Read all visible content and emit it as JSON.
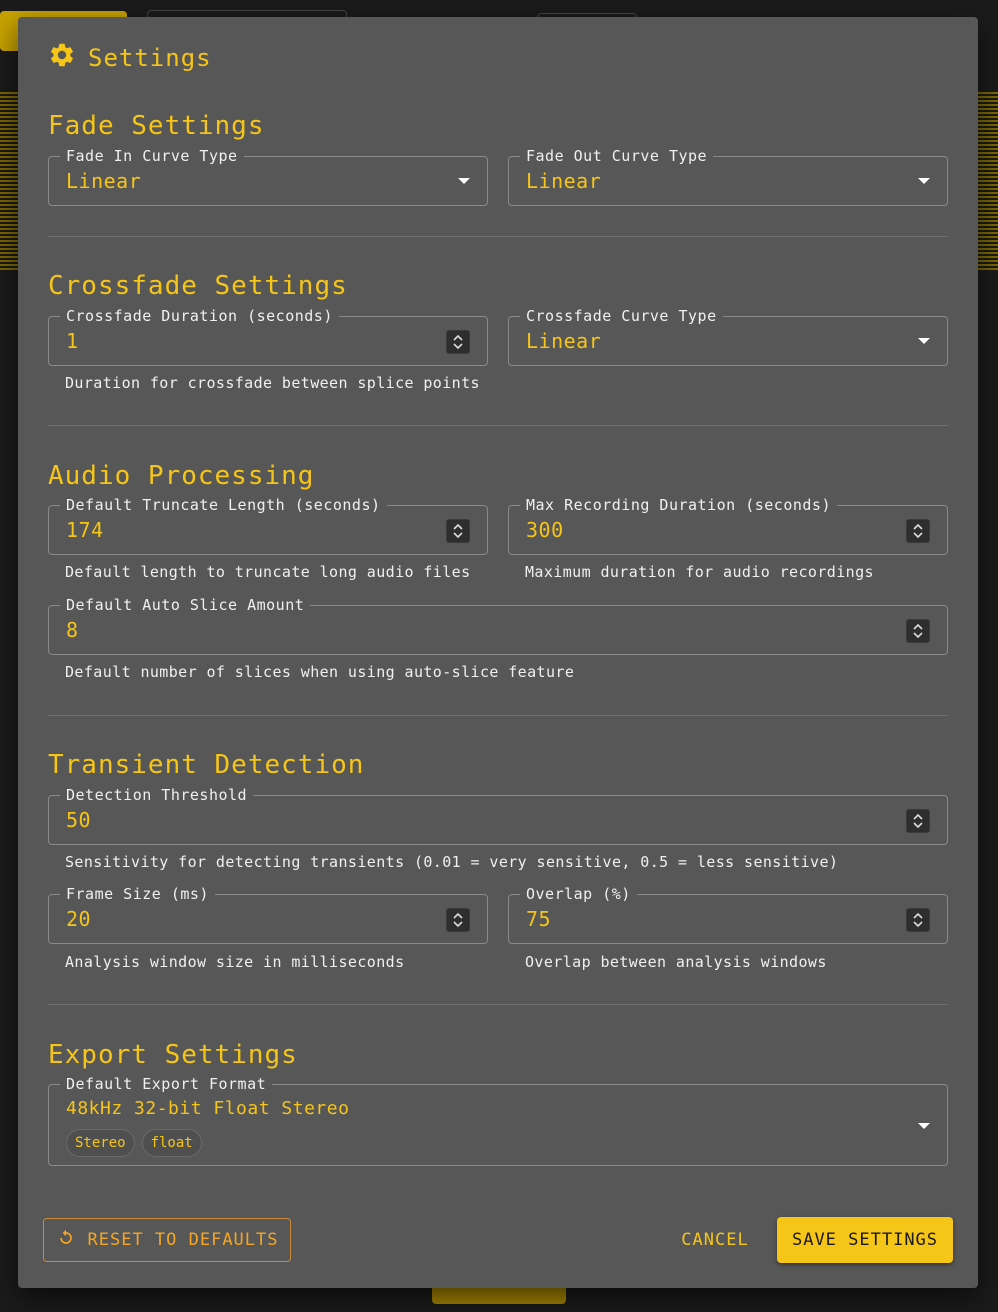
{
  "dialog": {
    "title": "Settings",
    "icon": "gear-icon",
    "accent": "#f5c518"
  },
  "fade": {
    "heading": "Fade Settings",
    "fade_in": {
      "label": "Fade In Curve Type",
      "value": "Linear"
    },
    "fade_out": {
      "label": "Fade Out Curve Type",
      "value": "Linear"
    }
  },
  "crossfade": {
    "heading": "Crossfade Settings",
    "duration": {
      "label": "Crossfade Duration (seconds)",
      "value": "1",
      "helper": "Duration for crossfade between splice points"
    },
    "curve": {
      "label": "Crossfade Curve Type",
      "value": "Linear"
    }
  },
  "audio": {
    "heading": "Audio Processing",
    "truncate": {
      "label": "Default Truncate Length (seconds)",
      "value": "174",
      "helper": "Default length to truncate long audio files"
    },
    "max_rec": {
      "label": "Max Recording Duration (seconds)",
      "value": "300",
      "helper": "Maximum duration for audio recordings"
    },
    "auto_slice": {
      "label": "Default Auto Slice Amount",
      "value": "8",
      "helper": "Default number of slices when using auto-slice feature"
    }
  },
  "transient": {
    "heading": "Transient Detection",
    "threshold": {
      "label": "Detection Threshold",
      "value": "50",
      "helper": "Sensitivity for detecting transients (0.01 = very sensitive, 0.5 = less sensitive)"
    },
    "frame": {
      "label": "Frame Size (ms)",
      "value": "20",
      "helper": "Analysis window size in milliseconds"
    },
    "overlap": {
      "label": "Overlap (%)",
      "value": "75",
      "helper": "Overlap between analysis windows"
    }
  },
  "export": {
    "heading": "Export Settings",
    "format": {
      "label": "Default Export Format",
      "value": "48kHz 32-bit Float Stereo",
      "chips": [
        "Stereo",
        "float"
      ]
    }
  },
  "actions": {
    "reset": "RESET TO DEFAULTS",
    "reset_icon": "refresh-icon",
    "cancel": "CANCEL",
    "save": "SAVE SETTINGS"
  }
}
